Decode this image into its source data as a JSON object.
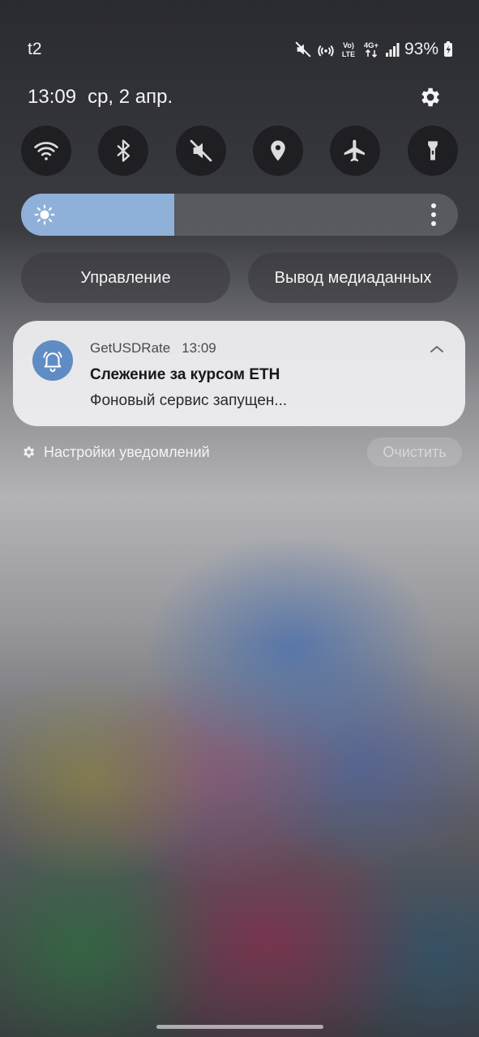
{
  "status_bar": {
    "carrier": "t2",
    "network_volte": "Vo) LTE",
    "network_type": "4G+",
    "battery_percent": "93%",
    "icons": [
      "mute-icon",
      "hotspot-icon",
      "volte-icon",
      "4g-plus-icon",
      "signal-icon",
      "battery-charging-icon"
    ]
  },
  "header": {
    "time": "13:09",
    "date": "ср, 2 апр."
  },
  "quick_settings": {
    "tiles": [
      {
        "name": "wifi",
        "icon": "wifi-icon"
      },
      {
        "name": "bluetooth",
        "icon": "bluetooth-icon"
      },
      {
        "name": "sound",
        "icon": "mute-icon"
      },
      {
        "name": "location",
        "icon": "location-icon"
      },
      {
        "name": "airplane",
        "icon": "airplane-icon"
      },
      {
        "name": "flashlight",
        "icon": "flashlight-icon"
      }
    ],
    "brightness_level": 0.35
  },
  "buttons": {
    "control": "Управление",
    "media_output": "Вывод медиаданных"
  },
  "notification": {
    "app": "GetUSDRate",
    "time": "13:09",
    "title": "Слежение за курсом ETH",
    "body": "Фоновый сервис запущен..."
  },
  "footer": {
    "notification_settings": "Настройки уведомлений",
    "clear": "Очистить"
  },
  "colors": {
    "accent": "#8fb0d8",
    "app_icon": "#5f8cc4"
  }
}
